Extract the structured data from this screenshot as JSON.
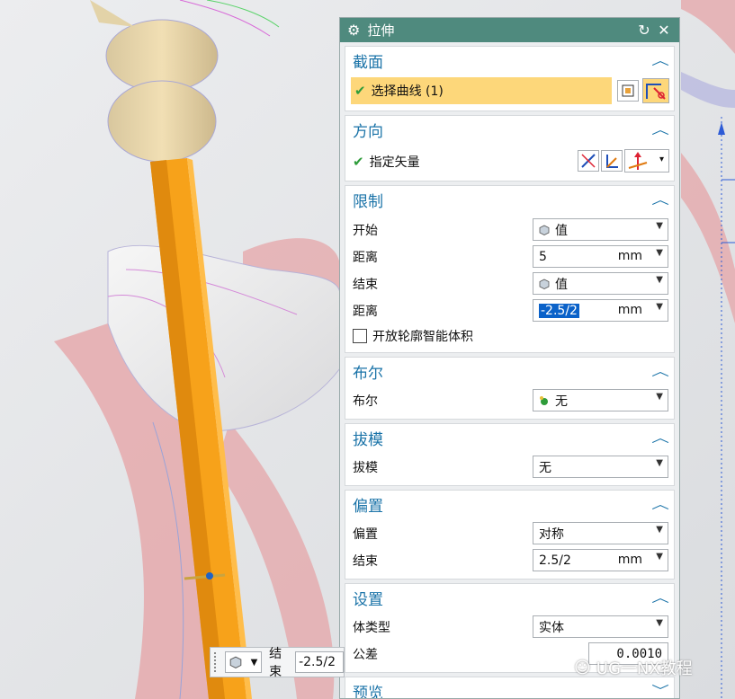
{
  "dialog": {
    "title": "拉伸",
    "reset_icon": "reset-icon",
    "close_icon": "close-icon",
    "section": {
      "title": "截面",
      "select_curve_label": "选择曲线 (1)"
    },
    "direction": {
      "title": "方向",
      "specify_vector_label": "指定矢量"
    },
    "limits": {
      "title": "限制",
      "start_label": "开始",
      "start_value": "值",
      "distance1_label": "距离",
      "distance1_value": "5",
      "distance1_unit": "mm",
      "end_label": "结束",
      "end_value": "值",
      "distance2_label": "距离",
      "distance2_value": "-2.5/2",
      "distance2_unit": "mm",
      "open_profile_label": "开放轮廓智能体积"
    },
    "boolean": {
      "title": "布尔",
      "label": "布尔",
      "value": "无"
    },
    "draft": {
      "title": "拔模",
      "label": "拔模",
      "value": "无"
    },
    "offset": {
      "title": "偏置",
      "offset_label": "偏置",
      "offset_value": "对称",
      "end_label": "结束",
      "end_value": "2.5/2",
      "end_unit": "mm"
    },
    "settings": {
      "title": "设置",
      "body_type_label": "体类型",
      "body_type_value": "实体",
      "tolerance_label": "公差",
      "tolerance_value": "0.0010"
    },
    "preview": {
      "title": "预览"
    }
  },
  "floating_toolbar": {
    "end_label": "结束",
    "end_value": "-2.5/2"
  },
  "watermark": "UG一NX教程",
  "colors": {
    "title_bar": "#4f8a7e",
    "section_title": "#1a73a8",
    "selection_highlight": "#fdd77a",
    "extrude_orange": "#f7a21a"
  }
}
